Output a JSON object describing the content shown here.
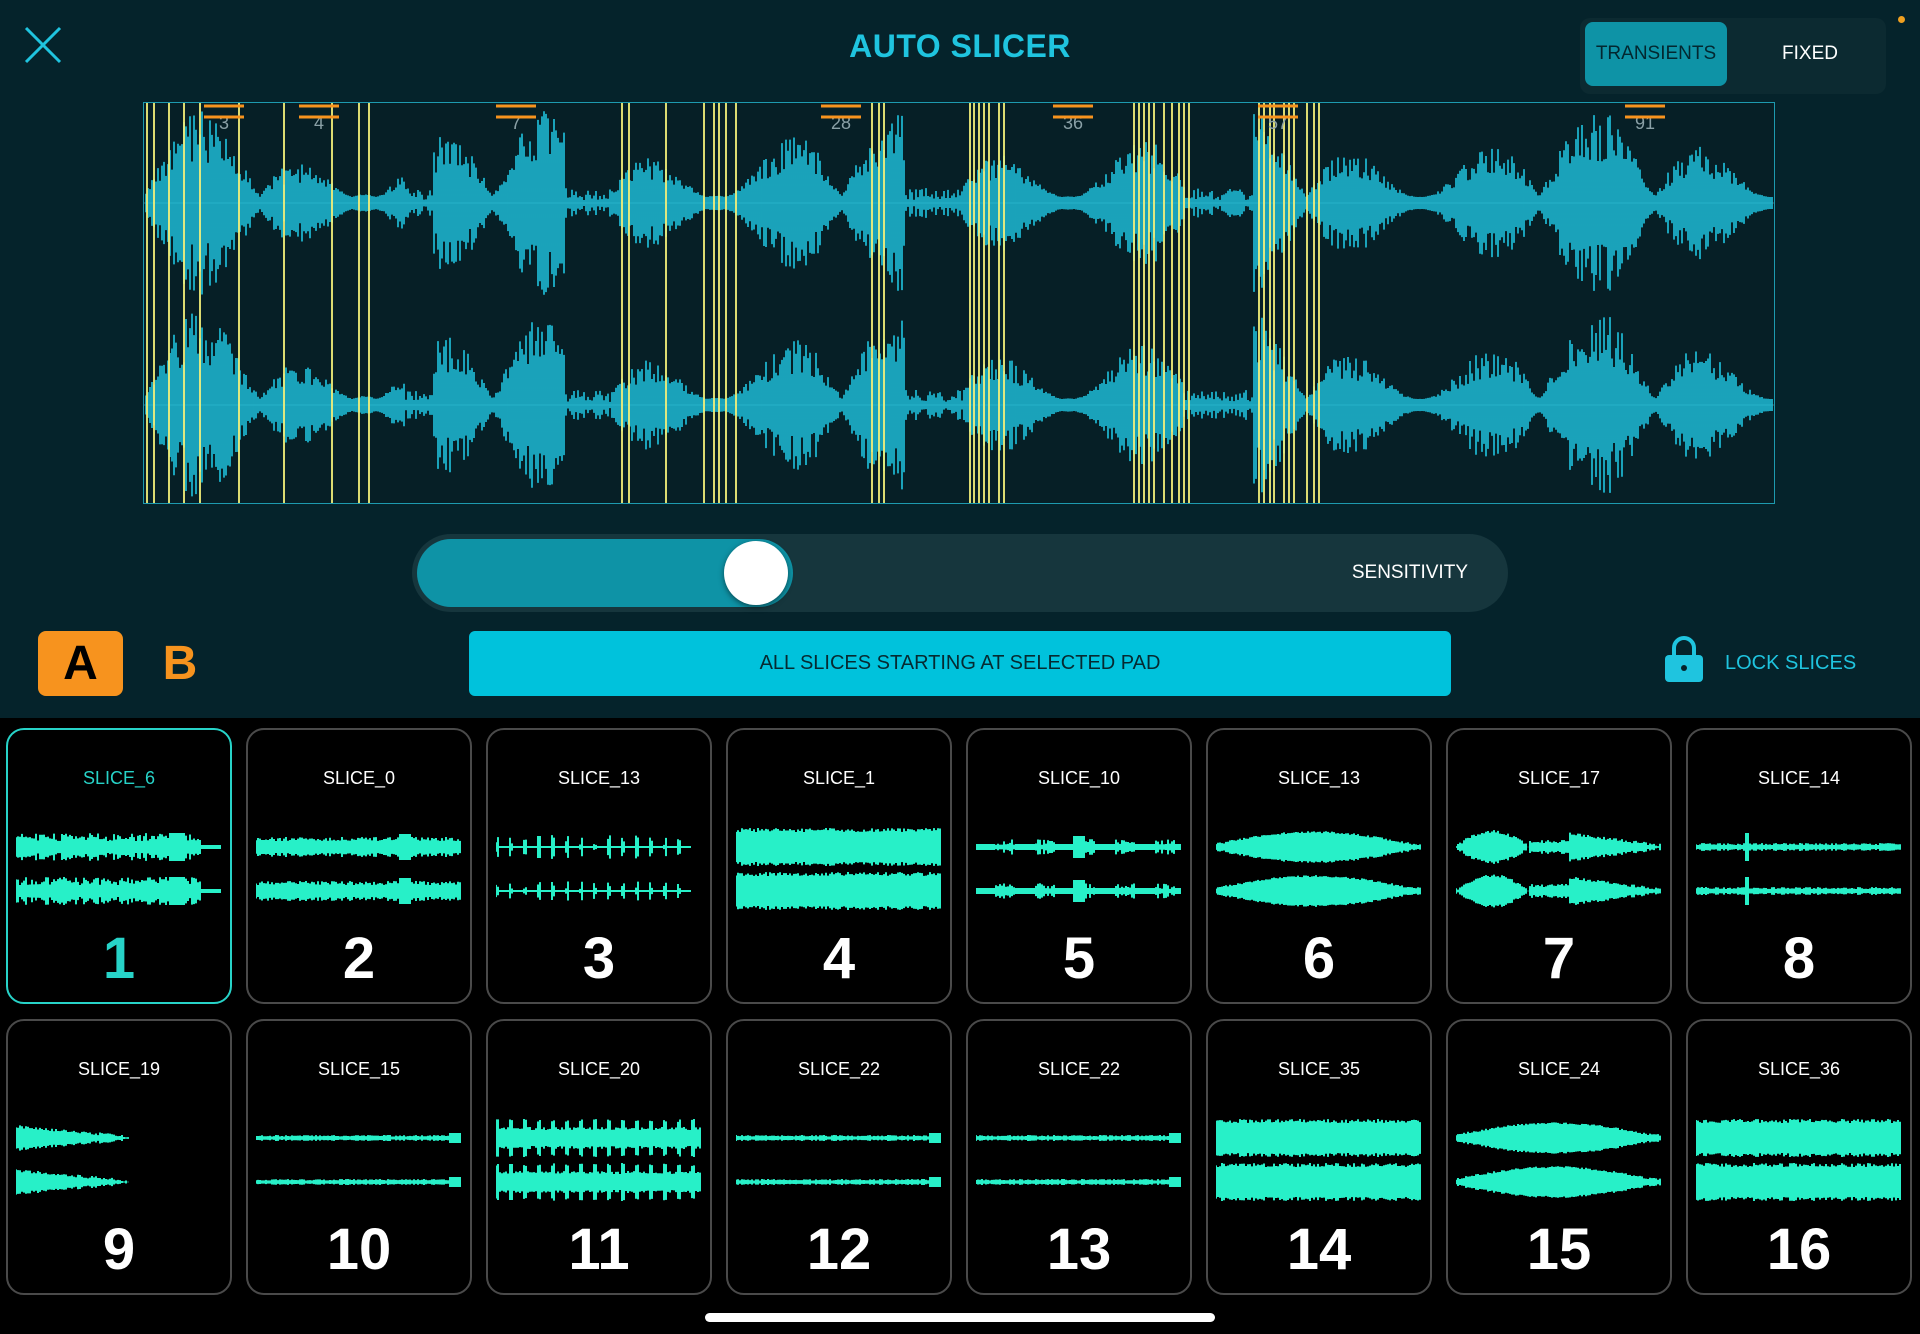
{
  "header": {
    "title": "AUTO SLICER",
    "close_icon": "close-icon",
    "mode_toggle": {
      "options": [
        "TRANSIENTS",
        "FIXED"
      ],
      "selected": "TRANSIENTS"
    }
  },
  "waveform": {
    "slice_labels": [
      "3",
      "4",
      "7",
      "28",
      "36",
      "57",
      "91"
    ],
    "marker_color": "#f4f07a",
    "wave_color": "#1fc4df",
    "handle_color": "#f7931e"
  },
  "sensitivity": {
    "label": "SENSITIVITY",
    "value": 0.3
  },
  "banks": {
    "a_label": "A",
    "b_label": "B",
    "selected": "A"
  },
  "actions": {
    "all_slices_label": "ALL SLICES STARTING AT SELECTED PAD",
    "lock_label": "LOCK SLICES",
    "lock_icon": "lock-icon"
  },
  "pads": [
    {
      "name": "SLICE_6",
      "number": "1",
      "selected": true
    },
    {
      "name": "SLICE_0",
      "number": "2"
    },
    {
      "name": "SLICE_13",
      "number": "3"
    },
    {
      "name": "SLICE_1",
      "number": "4"
    },
    {
      "name": "SLICE_10",
      "number": "5"
    },
    {
      "name": "SLICE_13",
      "number": "6"
    },
    {
      "name": "SLICE_17",
      "number": "7"
    },
    {
      "name": "SLICE_14",
      "number": "8"
    },
    {
      "name": "SLICE_19",
      "number": "9"
    },
    {
      "name": "SLICE_15",
      "number": "10"
    },
    {
      "name": "SLICE_20",
      "number": "11"
    },
    {
      "name": "SLICE_22",
      "number": "12"
    },
    {
      "name": "SLICE_22",
      "number": "13"
    },
    {
      "name": "SLICE_35",
      "number": "14"
    },
    {
      "name": "SLICE_24",
      "number": "15"
    },
    {
      "name": "SLICE_36",
      "number": "16"
    }
  ],
  "colors": {
    "accent": "#1fc4df",
    "pad_wave": "#27f0c8",
    "bank_orange": "#f7931e"
  }
}
